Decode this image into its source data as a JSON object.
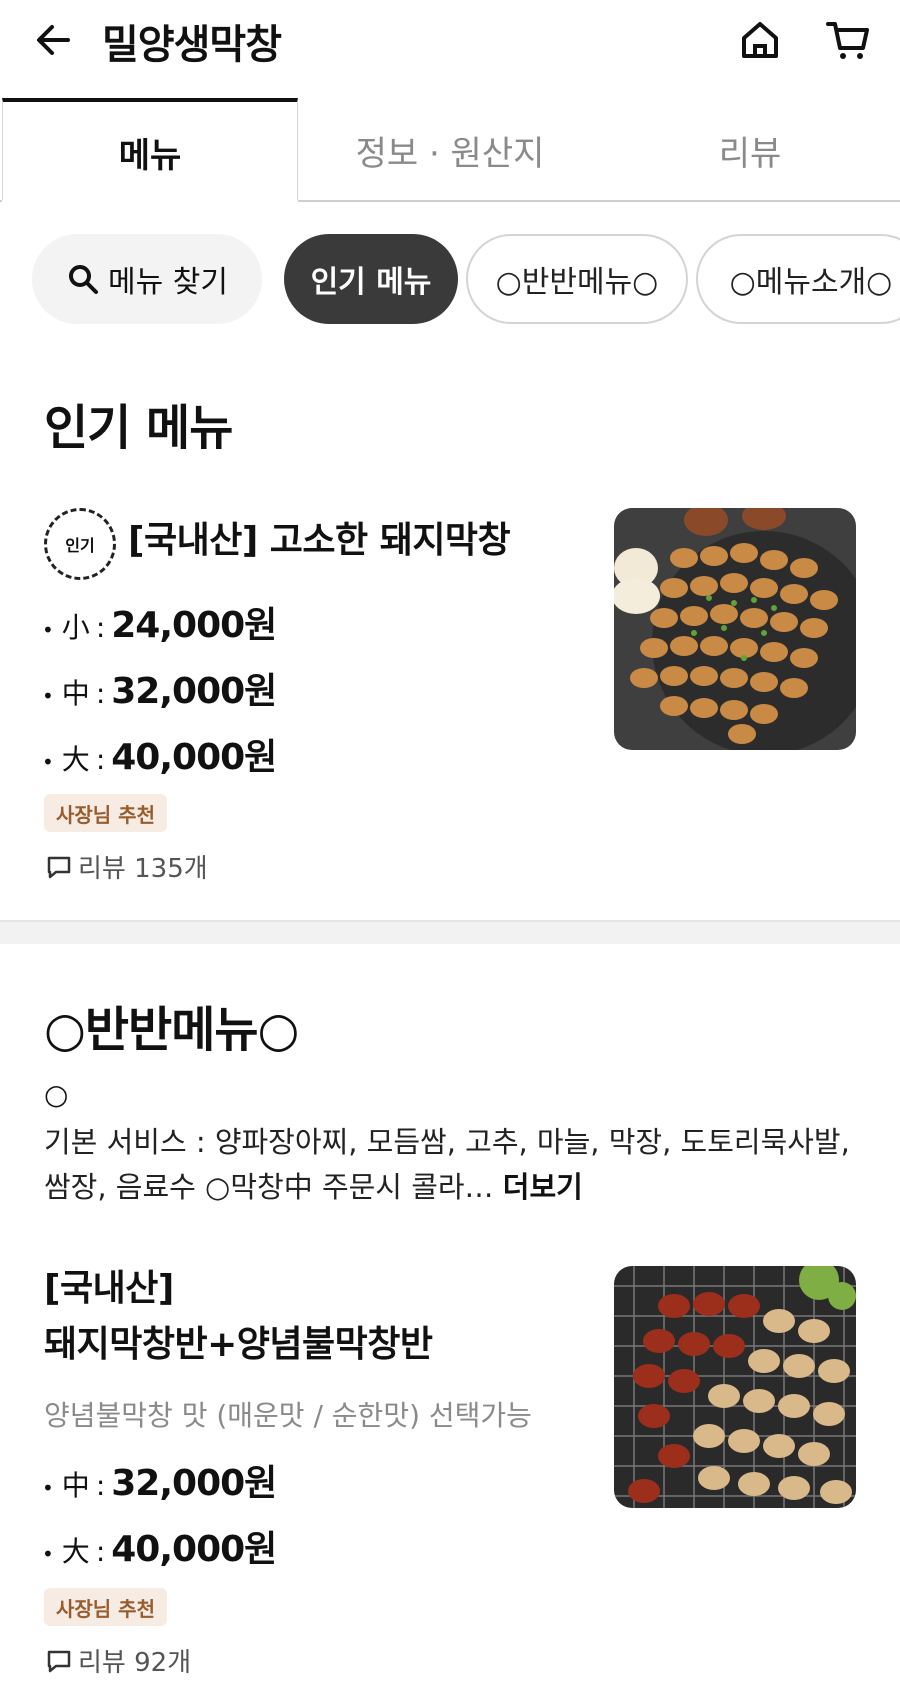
{
  "header": {
    "title": "밀양생막창"
  },
  "tabs": [
    {
      "label": "메뉴"
    },
    {
      "label": "정보 · 원산지"
    },
    {
      "label": "리뷰"
    }
  ],
  "chips": {
    "search_label": "메뉴 찾기",
    "items": [
      "인기 메뉴",
      "○반반메뉴○",
      "○메뉴소개○"
    ]
  },
  "sections": [
    {
      "title": "인기 메뉴",
      "items": [
        {
          "badge": "인기",
          "title": "[국내산] 고소한 돼지막창",
          "prices": [
            {
              "size": "小",
              "price": "24,000원"
            },
            {
              "size": "中",
              "price": "32,000원"
            },
            {
              "size": "大",
              "price": "40,000원"
            }
          ],
          "tag": "사장님 추천",
          "reviews": "리뷰 135개"
        }
      ]
    },
    {
      "title": "○반반메뉴○",
      "desc_circle": "○",
      "desc": "기본 서비스 : 양파장아찌, 모듬쌈, 고추, 마늘, 막장, 도토리묵사발, 쌈장, 음료수 ○막창中 주문시 콜라…",
      "more": "더보기",
      "items": [
        {
          "title_line1": "[국내산]",
          "title_line2": "돼지막창반+양념불막창반",
          "subtitle": "양념불막창 맛 (매운맛 / 순한맛) 선택가능",
          "prices": [
            {
              "size": "中",
              "price": "32,000원"
            },
            {
              "size": "大",
              "price": "40,000원"
            }
          ],
          "tag": "사장님 추천",
          "reviews": "리뷰 92개"
        }
      ]
    }
  ],
  "colors": {
    "active_chip_bg": "#3a3a3a",
    "owner_tag_bg": "#f6ece4",
    "owner_tag_text": "#9a5c2c"
  },
  "icons": [
    "back-arrow-icon",
    "home-icon",
    "cart-icon",
    "search-icon",
    "comment-icon"
  ]
}
